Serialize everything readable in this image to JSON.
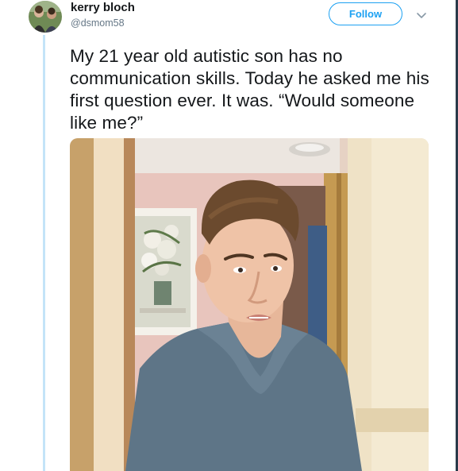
{
  "tweet": {
    "author": {
      "display_name": "kerry bloch",
      "handle": "@dsmom58"
    },
    "follow_label": "Follow",
    "text": "My 21 year old autistic son has no communication skills. Today he asked me his first question ever. It was. “Would someone like me?”",
    "icons": {
      "more": "chevron-down-icon",
      "avatar": "avatar"
    }
  },
  "colors": {
    "accent": "#1da1f2",
    "secondary_text": "#657786",
    "primary_text": "#14171a",
    "thread_line": "#c4e4f8"
  }
}
